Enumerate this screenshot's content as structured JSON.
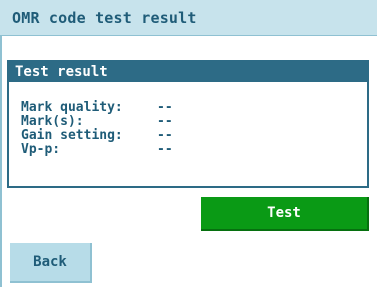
{
  "header": {
    "title": "OMR code test result"
  },
  "result_panel": {
    "title": "Test result",
    "rows": [
      {
        "label": "Mark quality:",
        "value": "--"
      },
      {
        "label": "Mark(s):",
        "value": "--"
      },
      {
        "label": "Gain setting:",
        "value": "--"
      },
      {
        "label": "Vp-p:",
        "value": "--"
      }
    ]
  },
  "buttons": {
    "test_label": "Test",
    "back_label": "Back"
  },
  "colors": {
    "title_bar": "#c7e3ec",
    "panel_header": "#2d6b86",
    "text": "#1f5c78",
    "test_button": "#0a9a15",
    "back_button": "#b7dce8"
  }
}
